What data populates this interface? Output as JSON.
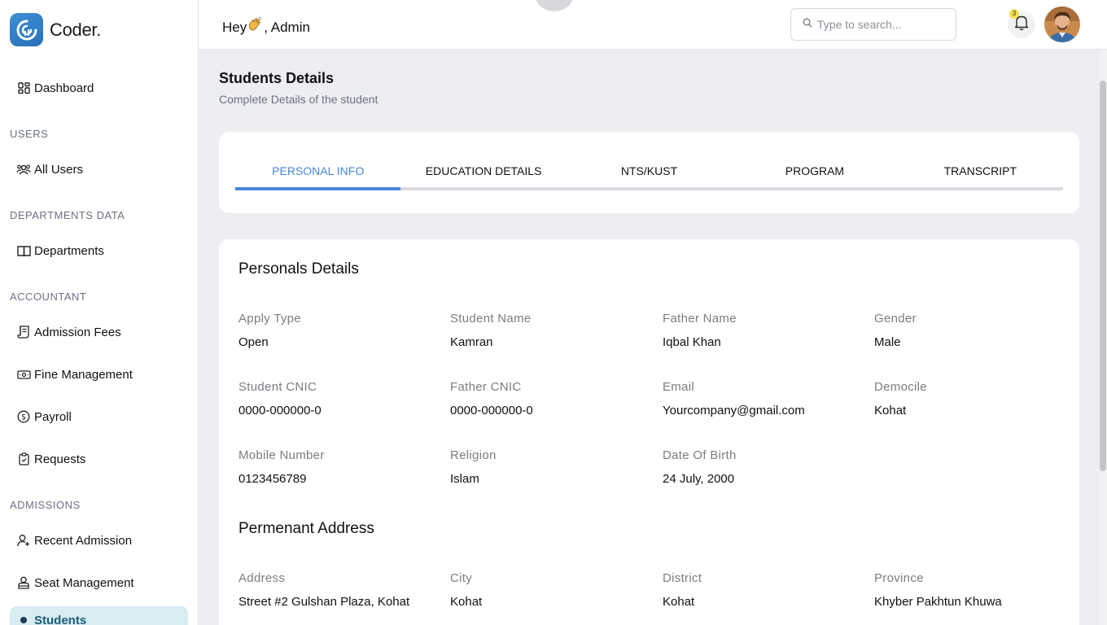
{
  "brand": {
    "name": "Coder."
  },
  "header": {
    "greeting_prefix": "Hey",
    "greeting_name": ", Admin",
    "search_placeholder": "Type to search...",
    "notification_count": "3"
  },
  "sidebar": {
    "dashboard": "Dashboard",
    "sections": {
      "users": "USERS",
      "departments": "DEPARTMENTS DATA",
      "accountant": "ACCOUNTANT",
      "admissions": "ADMISSIONS"
    },
    "items": {
      "all_users": "All Users",
      "departments": "Departments",
      "admission_fees": "Admission Fees",
      "fine_management": "Fine Management",
      "payroll": "Payroll",
      "requests": "Requests",
      "recent_admission": "Recent Admission",
      "seat_management": "Seat Management",
      "students": "Students"
    }
  },
  "page": {
    "title": "Students Details",
    "subtitle": "Complete Details of the student"
  },
  "tabs": [
    "PERSONAL INFO",
    "EDUCATION DETAILS",
    "NTS/KUST",
    "PROGRAM",
    "TRANSCRIPT"
  ],
  "personal": {
    "heading": "Personals Details",
    "fields": [
      {
        "label": "Apply Type",
        "value": "Open"
      },
      {
        "label": "Student Name",
        "value": "Kamran"
      },
      {
        "label": "Father Name",
        "value": "Iqbal Khan"
      },
      {
        "label": "Gender",
        "value": "Male"
      },
      {
        "label": "Student CNIC",
        "value": "0000-000000-0"
      },
      {
        "label": "Father CNIC",
        "value": "0000-000000-0"
      },
      {
        "label": "Email",
        "value": "Yourcompany@gmail.com"
      },
      {
        "label": "Democile",
        "value": "Kohat"
      },
      {
        "label": "Mobile Number",
        "value": "0123456789"
      },
      {
        "label": "Religion",
        "value": "Islam"
      },
      {
        "label": "Date Of Birth",
        "value": "24 July, 2000"
      }
    ]
  },
  "address": {
    "heading": "Permenant Address",
    "fields": [
      {
        "label": "Address",
        "value": "Street #2 Gulshan Plaza, Kohat"
      },
      {
        "label": "City",
        "value": "Kohat"
      },
      {
        "label": "District",
        "value": "Kohat"
      },
      {
        "label": "Province",
        "value": "Khyber Pakhtun Khuwa"
      }
    ]
  },
  "colors": {
    "accent": "#4a88d8",
    "brand": "#2f7fc8",
    "active_bg": "#d7ecf3"
  }
}
